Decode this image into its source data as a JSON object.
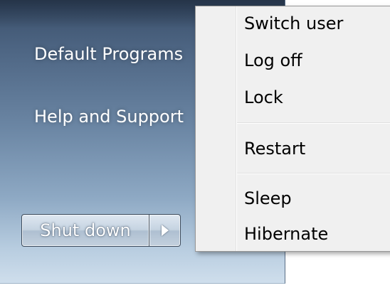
{
  "start_pane": {
    "links": [
      {
        "label": "Default Programs"
      },
      {
        "label": "Help and Support"
      }
    ],
    "shutdown": {
      "label": "Shut down",
      "arrow_icon": "triangle-right-icon"
    }
  },
  "power_menu": {
    "items": [
      {
        "label": "Switch user"
      },
      {
        "label": "Log off"
      },
      {
        "label": "Lock"
      },
      {
        "label": "Restart"
      },
      {
        "label": "Sleep"
      },
      {
        "label": "Hibernate"
      }
    ]
  },
  "colors": {
    "menu_background": "#f0f0f0",
    "menu_border": "#979797",
    "pane_top": "#3a4f6a",
    "pane_bottom": "#cfdeec",
    "link_text": "#ffffff"
  }
}
